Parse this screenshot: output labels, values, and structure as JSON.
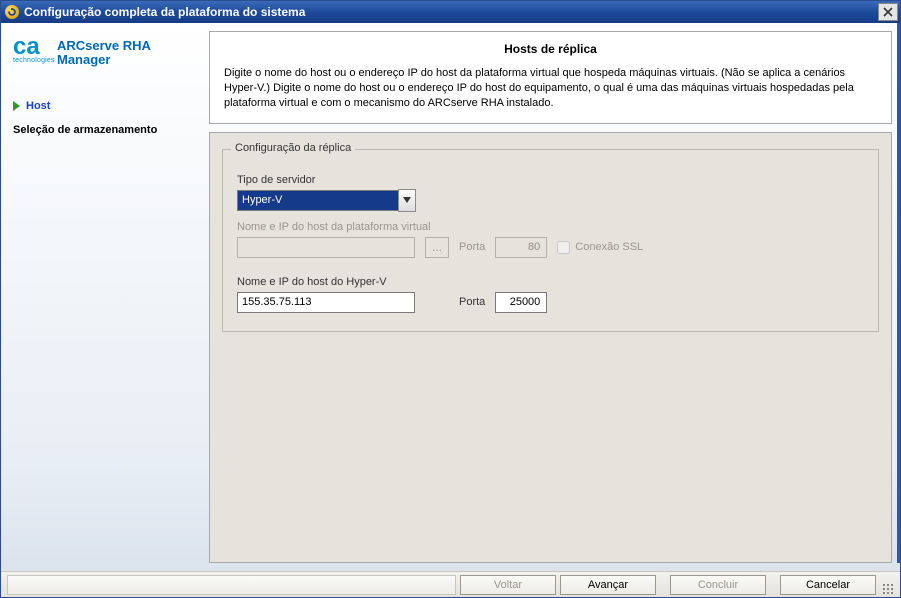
{
  "titlebar": {
    "title": "Configuração completa da plataforma do sistema"
  },
  "logo": {
    "brand_top": "ARCserve RHA",
    "brand_bottom": "Manager",
    "tech": "technologies"
  },
  "sidebar": {
    "items": [
      {
        "label": "Host",
        "current": true
      },
      {
        "label": "Seleção de armazenamento",
        "current": false
      }
    ]
  },
  "header": {
    "title": "Hosts de réplica",
    "description": "Digite o nome do host ou o endereço IP do host da plataforma virtual que hospeda máquinas virtuais. (Não se aplica a cenários Hyper-V.) Digite o nome do host ou o endereço IP do host do equipamento, o qual é uma das máquinas virtuais hospedadas pela plataforma virtual e com o mecanismo do ARCserve RHA instalado."
  },
  "form": {
    "legend": "Configuração da réplica",
    "server_type_label": "Tipo de servidor",
    "server_type_value": "Hyper-V",
    "vp_host_label": "Nome e IP do host da plataforma virtual",
    "vp_host_value": "",
    "vp_port_label": "Porta",
    "vp_port_value": "80",
    "ssl_label": "Conexão SSL",
    "hv_host_label": "Nome e IP do host do Hyper-V",
    "hv_host_value": "155.35.75.113",
    "hv_port_label": "Porta",
    "hv_port_value": "25000",
    "browse_label": "..."
  },
  "footer": {
    "back": "Voltar",
    "next": "Avançar",
    "finish": "Concluir",
    "cancel": "Cancelar"
  }
}
